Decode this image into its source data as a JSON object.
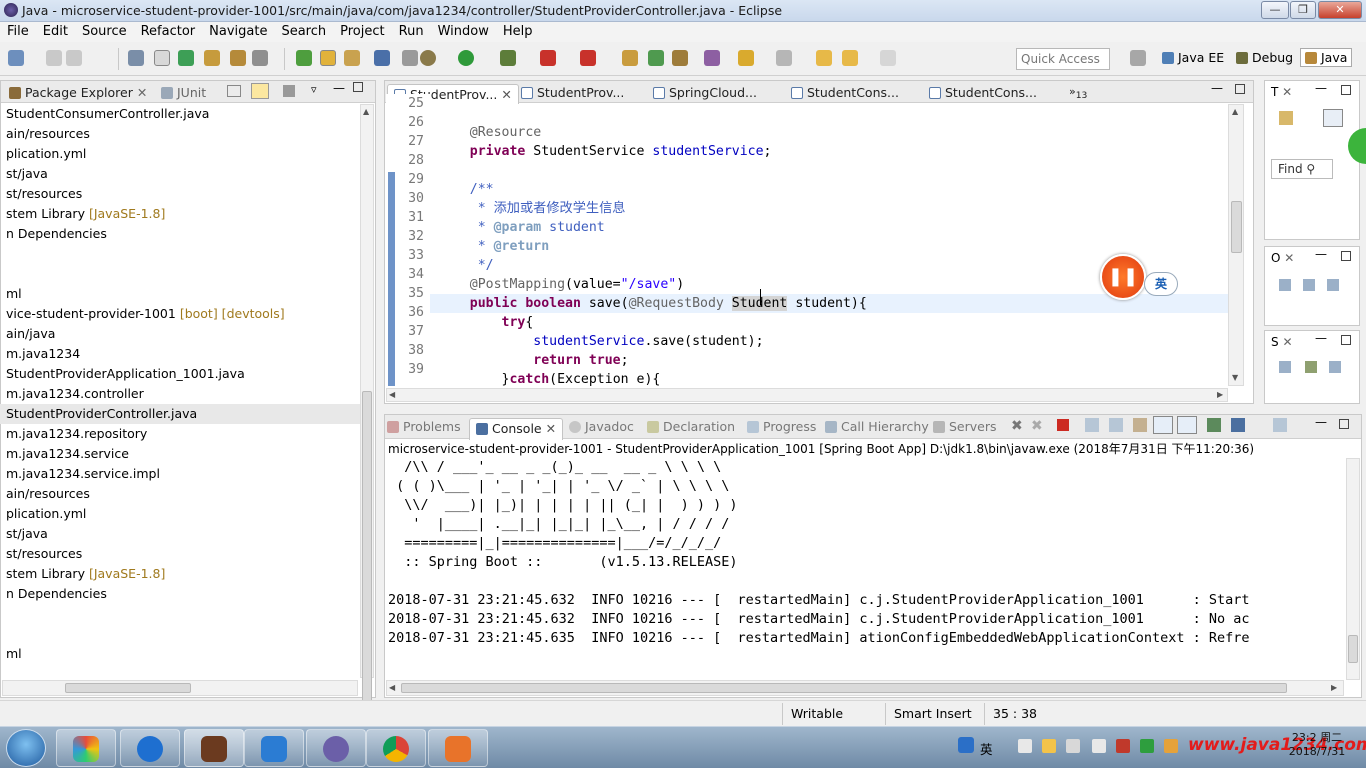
{
  "window": {
    "title": "Java - microservice-student-provider-1001/src/main/java/com/java1234/controller/StudentProviderController.java - Eclipse"
  },
  "menu": [
    "File",
    "Edit",
    "Source",
    "Refactor",
    "Navigate",
    "Search",
    "Project",
    "Run",
    "Window",
    "Help"
  ],
  "toolbar": {
    "quick_access": "Quick Access",
    "perspectives": [
      "Java EE",
      "Debug",
      "Java"
    ]
  },
  "package_explorer": {
    "tabs": [
      "Package Explorer",
      "JUnit"
    ],
    "items": [
      {
        "text": "StudentConsumerController.java",
        "decor": ""
      },
      {
        "text": "ain/resources",
        "decor": ""
      },
      {
        "text": "plication.yml",
        "decor": ""
      },
      {
        "text": "st/java",
        "decor": ""
      },
      {
        "text": "st/resources",
        "decor": ""
      },
      {
        "text": "stem Library",
        "decor": "[JavaSE-1.8]"
      },
      {
        "text": "n Dependencies",
        "decor": ""
      },
      {
        "text": "",
        "decor": ""
      },
      {
        "text": "",
        "decor": ""
      },
      {
        "text": "ml",
        "decor": ""
      },
      {
        "text": "vice-student-provider-1001",
        "decor": "[boot] [devtools]"
      },
      {
        "text": "ain/java",
        "decor": ""
      },
      {
        "text": "m.java1234",
        "decor": ""
      },
      {
        "text": "StudentProviderApplication_1001.java",
        "decor": ""
      },
      {
        "text": "m.java1234.controller",
        "decor": ""
      },
      {
        "text": "StudentProviderController.java",
        "decor": ""
      },
      {
        "text": "m.java1234.repository",
        "decor": ""
      },
      {
        "text": "m.java1234.service",
        "decor": ""
      },
      {
        "text": "m.java1234.service.impl",
        "decor": ""
      },
      {
        "text": "ain/resources",
        "decor": ""
      },
      {
        "text": "plication.yml",
        "decor": ""
      },
      {
        "text": "st/java",
        "decor": ""
      },
      {
        "text": "st/resources",
        "decor": ""
      },
      {
        "text": "stem Library",
        "decor": "[JavaSE-1.8]"
      },
      {
        "text": "n Dependencies",
        "decor": ""
      },
      {
        "text": "",
        "decor": ""
      },
      {
        "text": "",
        "decor": ""
      },
      {
        "text": "ml",
        "decor": ""
      }
    ]
  },
  "editor": {
    "tabs": [
      "StudentProv...",
      "StudentProv...",
      "SpringCloud...",
      "StudentCons...",
      "StudentCons..."
    ],
    "overflow_count": "13",
    "line_numbers": [
      "25",
      "26",
      "27",
      "28",
      "29",
      "30",
      "31",
      "32",
      "33",
      "34",
      "35",
      "36",
      "37",
      "38",
      "39"
    ],
    "lines": [
      "",
      "    @Resource",
      "    private StudentService studentService;",
      "",
      "    /**",
      "     * 添加或者修改学生信息",
      "     * @param student",
      "     * @return",
      "     */",
      "    @PostMapping(value=\"/save\")",
      "    public boolean save(@RequestBody Student student){",
      "        try{",
      "            studentService.save(student);",
      "            return true;",
      "        }catch(Exception e){"
    ]
  },
  "right_views": {
    "find_label": "Find",
    "letters": [
      "T",
      "O",
      "S"
    ]
  },
  "ime_badge": "英",
  "console": {
    "tabs": [
      "Problems",
      "Console",
      "Javadoc",
      "Declaration",
      "Progress",
      "Call Hierarchy",
      "Servers"
    ],
    "header": "microservice-student-provider-1001 - StudentProviderApplication_1001 [Spring Boot App] D:\\jdk1.8\\bin\\javaw.exe (2018年7月31日 下午11:20:36)",
    "lines": [
      "  /\\\\ / ___'_ __ _ _(_)_ __  __ _ \\ \\ \\ \\",
      " ( ( )\\___ | '_ | '_| | '_ \\/ _` | \\ \\ \\ \\",
      "  \\\\/  ___)| |_)| | | | | || (_| |  ) ) ) )",
      "   '  |____| .__|_| |_|_| |_\\__, | / / / /",
      "  =========|_|==============|___/=/_/_/_/",
      "  :: Spring Boot ::       (v1.5.13.RELEASE)",
      "",
      "2018-07-31 23:21:45.632  INFO 10216 --- [  restartedMain] c.j.StudentProviderApplication_1001      : Start",
      "2018-07-31 23:21:45.632  INFO 10216 --- [  restartedMain] c.j.StudentProviderApplication_1001      : No ac",
      "2018-07-31 23:21:45.635  INFO 10216 --- [  restartedMain] ationConfigEmbeddedWebApplicationContext : Refre"
    ]
  },
  "status": {
    "writable": "Writable",
    "insert_mode": "Smart Insert",
    "position": "35 : 38"
  },
  "taskbar": {
    "ime": "英",
    "watermark": "www.java1234.com",
    "clock_time": "23:2",
    "clock_day": "周二",
    "clock_date": "2018/7/31"
  }
}
